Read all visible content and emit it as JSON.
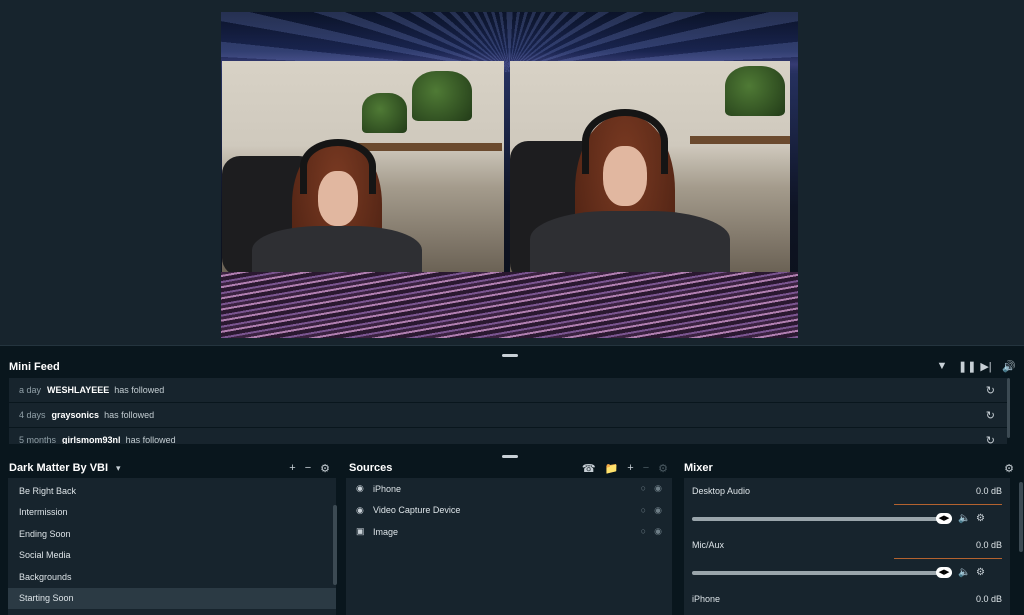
{
  "feed": {
    "title": "Mini Feed",
    "tools": [
      "filter-icon",
      "pause-icon",
      "skip-icon",
      "volume-icon"
    ],
    "events": [
      {
        "when": "a day",
        "user": "WESHLAYEEE",
        "action": "has followed"
      },
      {
        "when": "4 days",
        "user": "graysonics",
        "action": "has followed"
      },
      {
        "when": "5 months",
        "user": "girlsmom93nl",
        "action": "has followed"
      }
    ]
  },
  "scenes": {
    "collection": "Dark Matter By VBI",
    "dropdown_icon": "▾",
    "items": [
      "Be Right Back",
      "Intermission",
      "Ending Soon",
      "Social Media",
      "Backgrounds",
      "Starting Soon"
    ],
    "active": "Starting Soon"
  },
  "sources": {
    "title": "Sources",
    "items": [
      {
        "name": "iPhone",
        "icon": "webcam-icon"
      },
      {
        "name": "Video Capture Device",
        "icon": "webcam-icon"
      },
      {
        "name": "Image",
        "icon": "image-icon"
      }
    ]
  },
  "mixer": {
    "title": "Mixer",
    "items": [
      {
        "name": "Desktop Audio",
        "db": "0.0 dB",
        "volume": 1.0
      },
      {
        "name": "Mic/Aux",
        "db": "0.0 dB",
        "volume": 1.0
      },
      {
        "name": "iPhone",
        "db": "0.0 dB",
        "volume": 1.0
      }
    ]
  },
  "colors": {
    "background": "#09161d",
    "panel": "#17242d",
    "meter": "#b3622f"
  }
}
